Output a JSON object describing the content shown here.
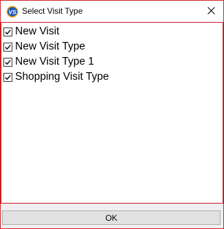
{
  "window": {
    "title": "Select Visit Type",
    "icon": "vs-app-icon",
    "icon_text": "VS",
    "accent_color": "#cf2027"
  },
  "visit_types": [
    {
      "label": "New Visit",
      "checked": true
    },
    {
      "label": "New Visit Type",
      "checked": true
    },
    {
      "label": "New Visit Type 1",
      "checked": true
    },
    {
      "label": "Shopping Visit Type",
      "checked": true
    }
  ],
  "buttons": {
    "ok_label": "OK"
  }
}
